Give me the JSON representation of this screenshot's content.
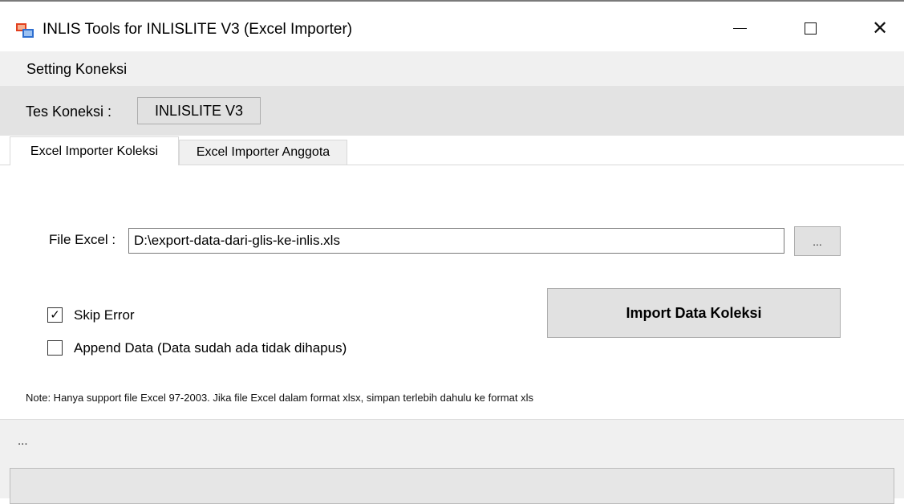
{
  "window": {
    "title": "INLIS Tools for INLISLITE V3 (Excel Importer)",
    "icon": "app-window-icon",
    "controls": {
      "minimize": "minimize-icon",
      "maximize": "maximize-icon",
      "close": "close-icon",
      "close_glyph": "✕"
    }
  },
  "menu": {
    "items": [
      "Setting Koneksi"
    ]
  },
  "toolbar": {
    "tes_label": "Tes Koneksi :",
    "connection_button": "INLISLITE V3"
  },
  "tabs": [
    {
      "label": "Excel Importer Koleksi",
      "active": true
    },
    {
      "label": "Excel Importer Anggota",
      "active": false
    }
  ],
  "form": {
    "file_label": "File Excel :",
    "file_value": "D:\\export-data-dari-glis-ke-inlis.xls",
    "browse_label": "...",
    "skip_error": {
      "label": "Skip Error",
      "checked": true,
      "mark": "✓"
    },
    "append_data": {
      "label": "Append Data (Data sudah ada tidak dihapus)",
      "checked": false
    },
    "import_button": "Import Data Koleksi",
    "note": "Note: Hanya support file Excel 97-2003. Jika file Excel dalam format xlsx, simpan terlebih dahulu ke format xls"
  },
  "status": {
    "text": "...",
    "progress": 0
  },
  "colors": {
    "progress_fill": "#06b025",
    "panel": "#f0f0f0",
    "toolbar": "#e3e3e3",
    "button": "#e1e1e1"
  }
}
